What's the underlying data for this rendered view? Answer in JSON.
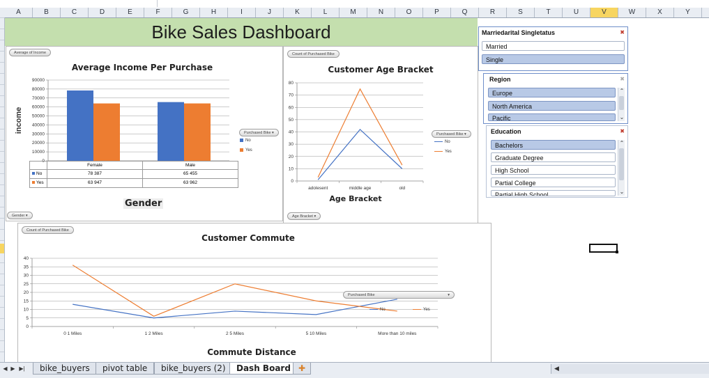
{
  "columns": [
    "A",
    "B",
    "C",
    "D",
    "E",
    "F",
    "G",
    "H",
    "I",
    "J",
    "K",
    "L",
    "M",
    "N",
    "O",
    "P",
    "Q",
    "R",
    "S",
    "T",
    "U",
    "V",
    "W",
    "X",
    "Y"
  ],
  "active_column": "V",
  "dashboard_title": "Bike Sales Dashboard",
  "colors": {
    "no": "#4472c4",
    "yes": "#ed7d31",
    "title_band": "#c4dfae",
    "slicer_selected": "#b8c9e6"
  },
  "income_chart": {
    "pivot_button": "Average of Income",
    "legend_button": "Purchased Bike",
    "axis_field_button": "Gender",
    "table_rows": [
      {
        "label": "No",
        "values": [
          "78 387",
          "65 455"
        ]
      },
      {
        "label": "Yes",
        "values": [
          "63 947",
          "63 962"
        ]
      }
    ]
  },
  "age_chart": {
    "pivot_button": "Count of Purchased Bike",
    "legend_button": "Purchased Bike",
    "axis_field_button": "Age Bracket"
  },
  "commute_chart": {
    "pivot_button": "Count of Purchased Bike",
    "legend_button": "Purchased Bike"
  },
  "chart_data": [
    {
      "type": "bar",
      "title": "Average Income Per Purchase",
      "xlabel": "Gender",
      "ylabel": "income",
      "categories": [
        "Female",
        "Male"
      ],
      "series": [
        {
          "name": "No",
          "values": [
            78387,
            65455
          ]
        },
        {
          "name": "Yes",
          "values": [
            63947,
            63962
          ]
        }
      ],
      "ylim": [
        0,
        90000
      ],
      "yticks": [
        "0",
        "10000",
        "20000",
        "30000",
        "40000",
        "50000",
        "60000",
        "70000",
        "80000",
        "90000"
      ],
      "grid": true,
      "legend": "right"
    },
    {
      "type": "line",
      "title": "Customer Age Bracket",
      "xlabel": "Age Bracket",
      "ylabel": "",
      "categories": [
        "adolesent",
        "middle age",
        "old"
      ],
      "series": [
        {
          "name": "No",
          "values": [
            1,
            42,
            10
          ]
        },
        {
          "name": "Yes",
          "values": [
            3,
            75,
            13
          ]
        }
      ],
      "ylim": [
        0,
        80
      ],
      "yticks": [
        "0",
        "10",
        "20",
        "30",
        "40",
        "50",
        "60",
        "70",
        "80"
      ],
      "grid": true,
      "legend": "right"
    },
    {
      "type": "line",
      "title": "Customer Commute",
      "xlabel": "Commute Distance",
      "ylabel": "",
      "categories": [
        "0 1 Miles",
        "1 2 Miles",
        "2 5 Miles",
        "5 10 Miles",
        "More than 10 miles"
      ],
      "series": [
        {
          "name": "No",
          "values": [
            13,
            5,
            9,
            7,
            16
          ]
        },
        {
          "name": "Yes",
          "values": [
            36,
            6,
            25,
            15,
            9
          ]
        }
      ],
      "ylim": [
        0,
        40
      ],
      "yticks": [
        "0",
        "5",
        "10",
        "15",
        "20",
        "25",
        "30",
        "35",
        "40"
      ],
      "grid": true,
      "legend": "right"
    }
  ],
  "slicers": {
    "marital": {
      "title": "Marriedarital Singletatus",
      "items": [
        {
          "label": "Married",
          "selected": false
        },
        {
          "label": "Single",
          "selected": true
        }
      ]
    },
    "region": {
      "title": "Region",
      "items": [
        {
          "label": "Europe",
          "selected": true
        },
        {
          "label": "North America",
          "selected": true
        },
        {
          "label": "Pacific",
          "selected": true
        }
      ]
    },
    "education": {
      "title": "Education",
      "items": [
        {
          "label": "Bachelors",
          "selected": true
        },
        {
          "label": "Graduate Degree",
          "selected": false
        },
        {
          "label": "High School",
          "selected": false
        },
        {
          "label": "Partial College",
          "selected": false
        },
        {
          "label": "Partial High School",
          "selected": false
        }
      ]
    }
  },
  "sheet_tabs": [
    {
      "label": "bike_buyers",
      "active": false
    },
    {
      "label": "pivot table",
      "active": false
    },
    {
      "label": "bike_buyers (2)",
      "active": false
    },
    {
      "label": "Dash Board",
      "active": true
    }
  ],
  "icons": {
    "nav_first": "first-sheet-icon",
    "nav_prev": "prev-sheet-icon",
    "nav_next": "next-sheet-icon",
    "nav_last": "last-sheet-icon",
    "new_sheet": "insert-sheet-icon",
    "clear_filter": "clear-filter-icon"
  }
}
